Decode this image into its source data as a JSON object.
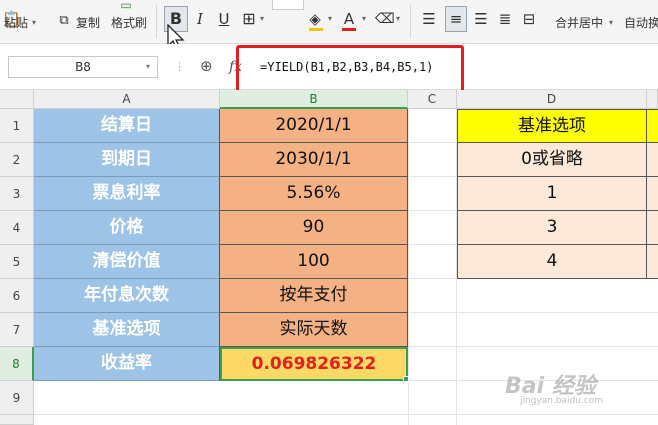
{
  "ribbon": {
    "paste": "粘贴",
    "copy": "复制",
    "format_painter": "格式刷",
    "bold": "B",
    "italic": "I",
    "underline": "U",
    "font_color_letter": "A",
    "merge_center": "合并居中",
    "auto_wrap": "自动换"
  },
  "formula_bar": {
    "name_box": "B8",
    "fx": "fx",
    "formula": "=YIELD(B1,B2,B3,B4,B5,1)"
  },
  "columns": [
    "A",
    "B",
    "C",
    "D"
  ],
  "rows": [
    "1",
    "2",
    "3",
    "4",
    "5",
    "6",
    "7",
    "8",
    "9"
  ],
  "table_main": [
    {
      "label": "结算日",
      "value": "2020/1/1"
    },
    {
      "label": "到期日",
      "value": "2030/1/1"
    },
    {
      "label": "票息利率",
      "value": "5.56%"
    },
    {
      "label": "价格",
      "value": "90"
    },
    {
      "label": "清偿价值",
      "value": "100"
    },
    {
      "label": "年付息次数",
      "value": "按年支付"
    },
    {
      "label": "基准选项",
      "value": "实际天数"
    },
    {
      "label": "收益率",
      "value": "0.069826322"
    }
  ],
  "basis_table": [
    "基准选项",
    "0或省略",
    "1",
    "3",
    "4"
  ],
  "watermark": {
    "text": "Bai 经验",
    "url": "jingyan.baidu.com"
  },
  "colors": {
    "label_fill": "#9dc3e6",
    "value_fill": "#f4b183",
    "header_yellow": "#ffff00",
    "result_fill": "#ffd966",
    "result_text": "#e3201b",
    "highlight_box": "#e02020"
  }
}
